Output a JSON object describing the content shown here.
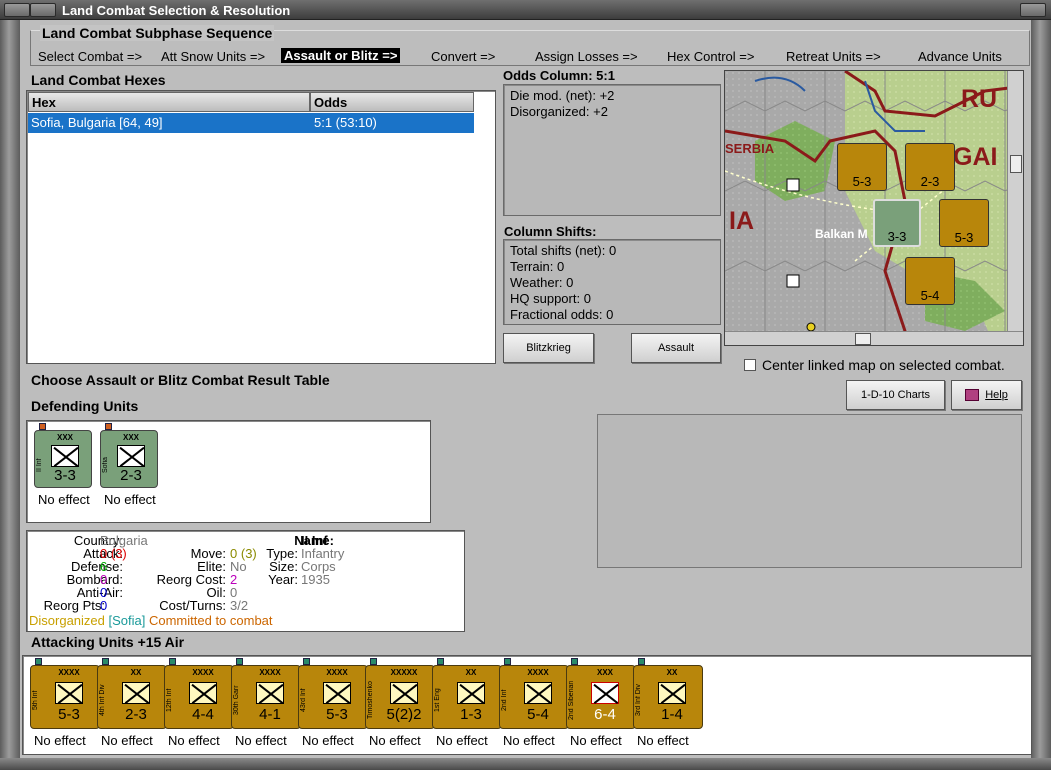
{
  "window": {
    "title": "Land Combat Selection & Resolution"
  },
  "sequence": {
    "heading": "Land Combat Subphase Sequence",
    "steps": [
      "Select Combat =>",
      "Att Snow Units =>",
      "Assault or Blitz =>",
      "Convert =>",
      "Assign Losses =>",
      "Hex Control =>",
      "Retreat Units =>",
      "Advance Units"
    ],
    "active_index": 2
  },
  "hexes": {
    "heading": "Land Combat Hexes",
    "columns": [
      "Hex",
      "Odds"
    ],
    "rows": [
      {
        "hex": "Sofia, Bulgaria [64, 49]",
        "odds": "5:1 (53:10)"
      }
    ]
  },
  "odds": {
    "heading": "Odds Column: 5:1",
    "lines": [
      "Die mod. (net): +2",
      "Disorganized: +2"
    ]
  },
  "shifts": {
    "heading": "Column Shifts:",
    "lines": [
      "Total shifts (net): 0",
      "Terrain: 0",
      "Weather: 0",
      "HQ support: 0",
      "Fractional odds: 0"
    ]
  },
  "buttons": {
    "blitz": "Blitzkrieg",
    "assault": "Assault",
    "charts": "1-D-10 Charts",
    "help": "Help"
  },
  "map": {
    "labels": [
      "RU",
      "GAI",
      "SERBIA",
      "IA",
      "Balkan M"
    ],
    "center_checkbox": "Center linked map on selected combat.",
    "center_checked": false
  },
  "choose_heading": "Choose Assault or Blitz Combat Result Table",
  "defending": {
    "heading": "Defending Units",
    "units": [
      {
        "name": "II Inf",
        "size": "XXX",
        "nation": "BUL",
        "value": "3-3",
        "effect": "No effect"
      },
      {
        "name": "Sofia",
        "size": "XXX",
        "nation": "BUL",
        "symbol": "M",
        "flag": "R",
        "value": "2-3",
        "effect": "No effect"
      }
    ]
  },
  "info": {
    "country_label": "Country:",
    "country": "Bulgaria",
    "attack_label": "Attack:",
    "attack": "0",
    "attack_alt": "(3)",
    "defense_label": "Defense:",
    "defense": "6",
    "bombard_label": "Bombard:",
    "bombard": "0",
    "antiair_label": "Anti-Air:",
    "antiair": "0",
    "reorgpts_label": "Reorg Pts:",
    "reorgpts": "0",
    "name_label": "Name:",
    "name": "II Inf",
    "move_label": "Move:",
    "move": "0",
    "move_alt": "(3)",
    "type_label": "Type:",
    "type": "Infantry",
    "elite_label": "Elite:",
    "elite": "No",
    "size_label": "Size:",
    "size": "Corps",
    "reorgcost_label": "Reorg Cost:",
    "reorgcost": "2",
    "year_label": "Year:",
    "year": "1935",
    "oil_label": "Oil:",
    "oil": "0",
    "costturns_label": "Cost/Turns:",
    "costturns": "3/2",
    "status1": "Disorganized",
    "status2": "[Sofia]",
    "status3": "Committed to combat"
  },
  "attacking": {
    "heading": "Attacking Units +15 Air",
    "units": [
      {
        "name": "5th Inf",
        "size": "XXXX",
        "value": "5-3",
        "effect": "No effect"
      },
      {
        "name": "4th Inf Div",
        "size": "XX",
        "value": "2-3",
        "effect": "No effect"
      },
      {
        "name": "12th Inf",
        "size": "XXXX",
        "value": "4-4",
        "effect": "No effect"
      },
      {
        "name": "30th Garr",
        "size": "XXXX",
        "value": "4-1",
        "effect": "No effect"
      },
      {
        "name": "43rd Inf",
        "size": "XXXX",
        "value": "5-3",
        "effect": "No effect"
      },
      {
        "name": "Timoshenko",
        "size": "XXXXX",
        "value": "5(2)2",
        "effect": "No effect"
      },
      {
        "name": "1st Eng",
        "size": "XX",
        "value": "1-3",
        "effect": "No effect"
      },
      {
        "name": "2nd Inf",
        "size": "XXXX",
        "value": "5-4",
        "effect": "No effect"
      },
      {
        "name": "2nd Siberian",
        "size": "XXX",
        "value": "6-4",
        "effect": "No effect"
      },
      {
        "name": "3rd Inf Div",
        "size": "XX",
        "value": "1-4",
        "effect": "No effect"
      }
    ]
  },
  "colors": {
    "soviet": "#b8860b",
    "bulgarian": "#7aa07a",
    "selection": "#1a73c8",
    "disorganized": "#c8a000",
    "committed": "#cc6600"
  }
}
